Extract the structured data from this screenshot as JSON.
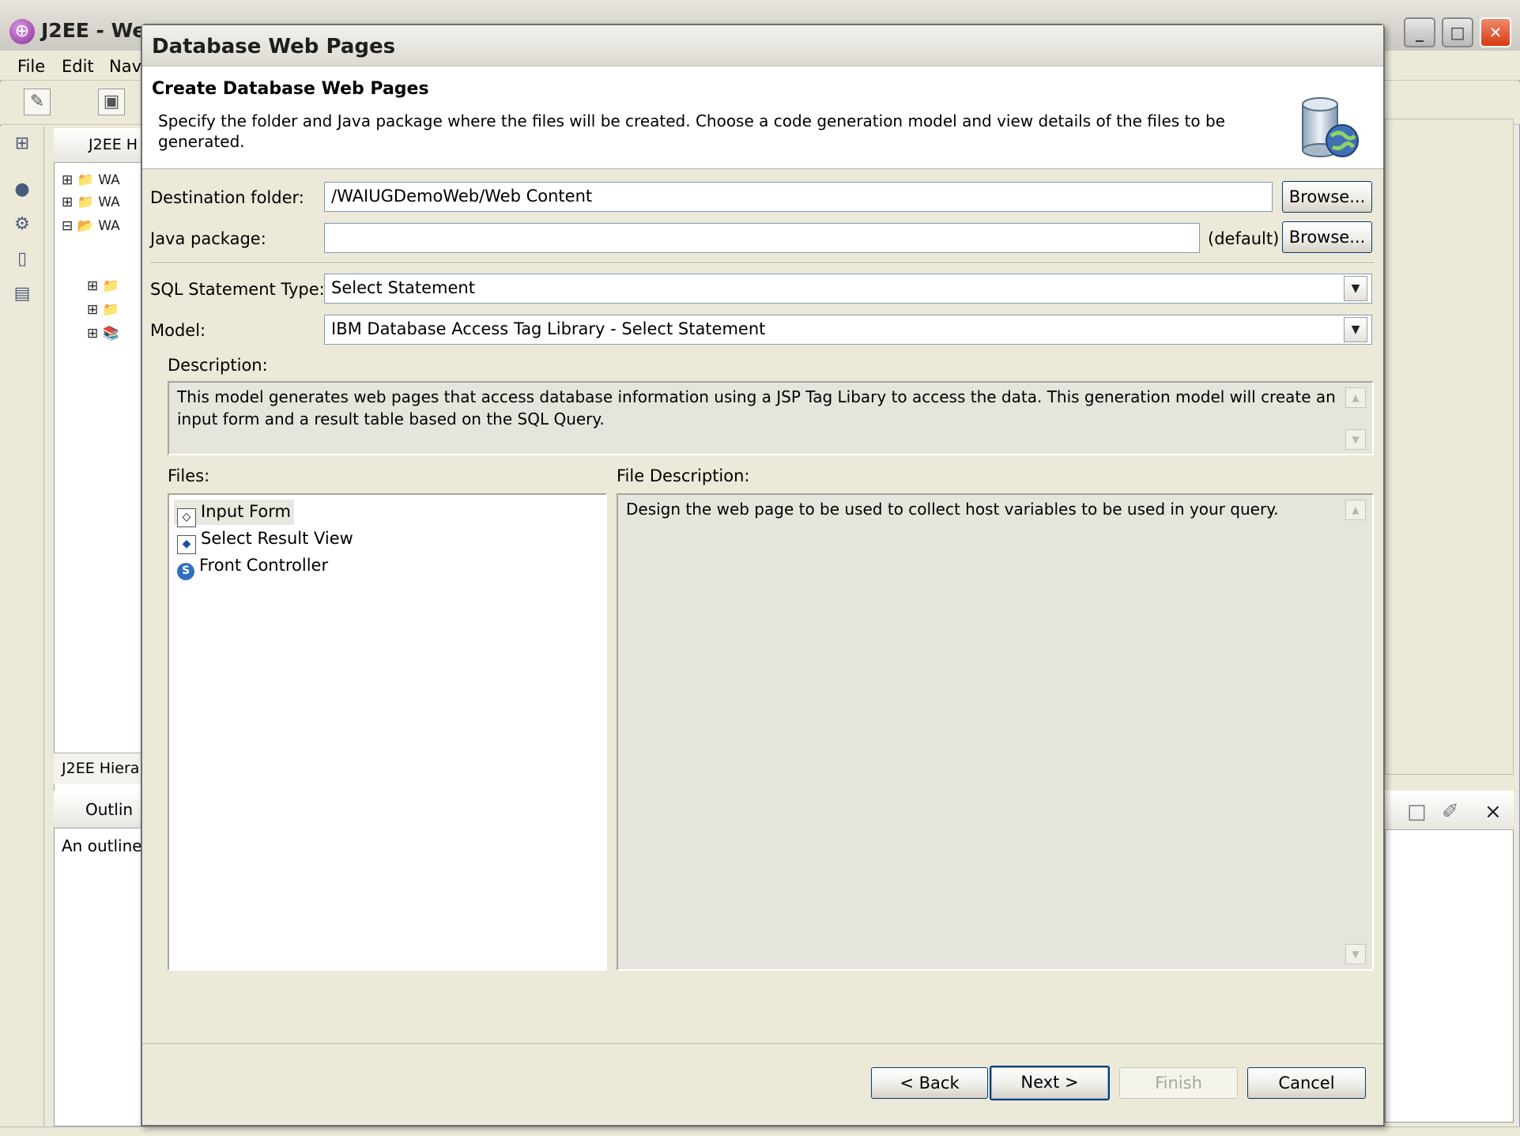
{
  "ide": {
    "title": "J2EE - We",
    "menu": [
      "File",
      "Edit",
      "Nav"
    ],
    "hierarchy_tab": "J2EE H",
    "tree_items": [
      "WA",
      "WA",
      "WA"
    ],
    "hierarchy_footer": "J2EE Hiera",
    "outline_tab": "Outlin",
    "outline_text": "An outline",
    "window_buttons": {
      "minimize": "_",
      "maximize": "□",
      "close": "✕"
    }
  },
  "dialog": {
    "title": "Database Web Pages",
    "banner_heading": "Create Database Web Pages",
    "banner_description": "Specify the folder and Java package where the files will be created. Choose a code generation model and view details of the files to be generated.",
    "destination_folder": {
      "label": "Destination folder:",
      "value": "/WAIUGDemoWeb/Web Content",
      "browse": "Browse..."
    },
    "java_package": {
      "label": "Java package:",
      "value": "",
      "suffix": "(default)",
      "browse": "Browse..."
    },
    "sql_statement_type": {
      "label": "SQL Statement Type:",
      "value": "Select Statement"
    },
    "model": {
      "label": "Model:",
      "value": "IBM Database Access Tag Library - Select Statement"
    },
    "description": {
      "label": "Description:",
      "text": "This model generates web pages that access database information using a JSP Tag Libary to access the data. This generation model will create an input form and a result table based on the SQL Query."
    },
    "files": {
      "label": "Files:",
      "items": [
        {
          "name": "Input Form",
          "icon": "form-icon"
        },
        {
          "name": "Select Result View",
          "icon": "result-view-icon"
        },
        {
          "name": "Front Controller",
          "icon": "servlet-icon"
        }
      ]
    },
    "file_description": {
      "label": "File Description:",
      "text": "Design the web page to be used to collect host variables to be used in your query."
    },
    "buttons": {
      "back": "< Back",
      "next": "Next >",
      "finish": "Finish",
      "cancel": "Cancel"
    }
  }
}
